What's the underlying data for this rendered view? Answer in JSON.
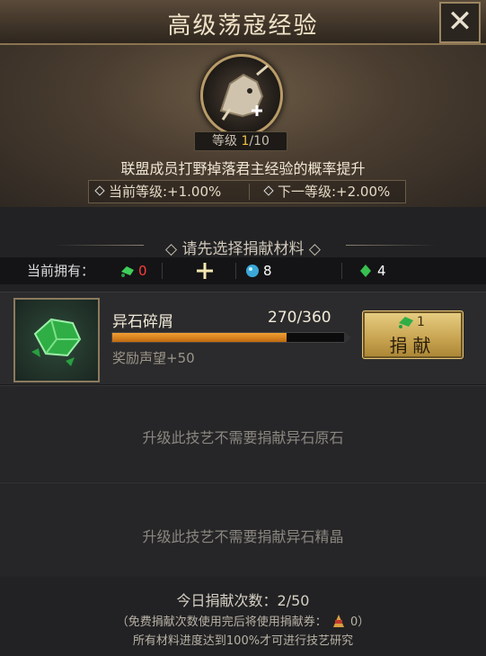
{
  "header": {
    "title": "高级荡寇经验",
    "close_label": "✕"
  },
  "skill": {
    "level_label": "等级",
    "level_current": "1",
    "level_rest": "/10",
    "description": "联盟成员打野掉落君主经验的概率提升",
    "current_rate": "当前等级:+1.00%",
    "next_rate": "下一等级:+2.00%"
  },
  "choose_title": "请先选择捐献材料",
  "holdings": {
    "label": "当前拥有：",
    "items": [
      {
        "icon": "green-shard-icon",
        "value": "0",
        "color": "#ff3b3b"
      },
      {
        "icon": "blue-crystal-icon",
        "value": "8",
        "color": "#ffffff"
      },
      {
        "icon": "green-gem-icon",
        "value": "4",
        "color": "#ffffff"
      }
    ]
  },
  "materials": [
    {
      "name": "异石碎屑",
      "progress_text": "270/360",
      "progress": 0.75,
      "reward": "奖励声望+50",
      "donate_count": "1",
      "donate_label": "捐献"
    }
  ],
  "messages": [
    "升级此技艺不需要捐献异石原石",
    "升级此技艺不需要捐献异石精晶"
  ],
  "footer": {
    "daily": "今日捐献次数：2/50",
    "note_prefix": "（免费捐献次数使用完后将使用捐献券：",
    "ticket_count": "0",
    "note_suffix": "）",
    "requirement": "所有材料进度达到100%才可进行技艺研究"
  }
}
